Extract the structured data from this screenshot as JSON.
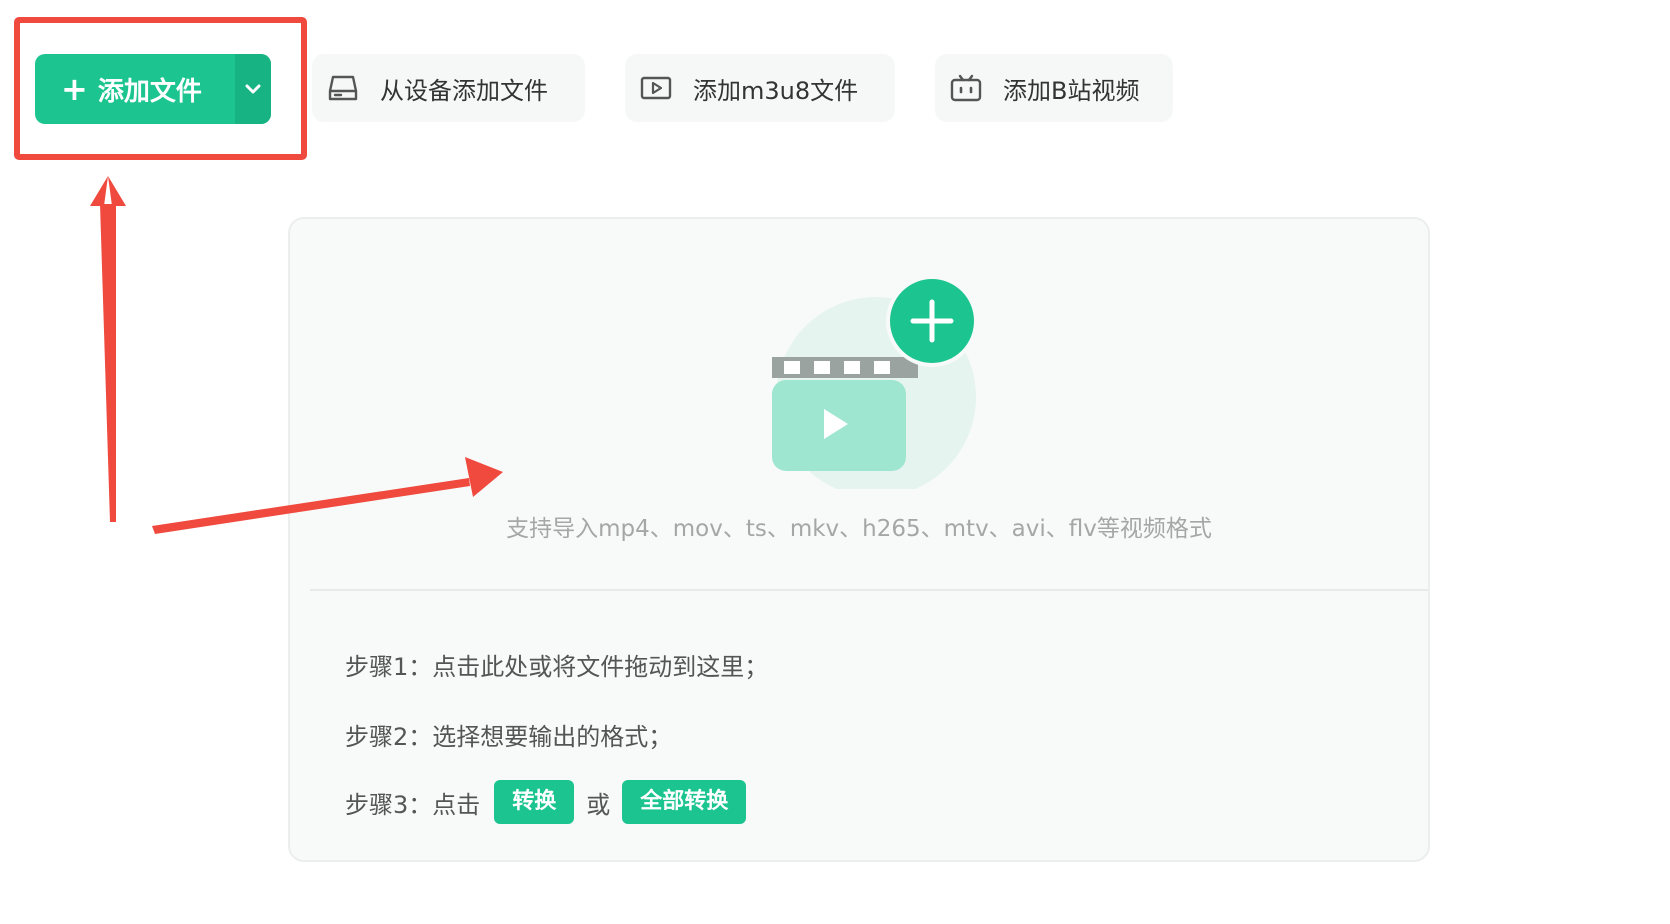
{
  "toolbar": {
    "add_file_label": "添加文件",
    "add_from_device_label": "从设备添加文件",
    "add_m3u8_label": "添加m3u8文件",
    "add_bilibili_label": "添加B站视频"
  },
  "dropzone": {
    "formats_hint": "支持导入mp4、mov、ts、mkv、h265、mtv、avi、flv等视频格式",
    "step1": "步骤1：点击此处或将文件拖动到这里；",
    "step2": "步骤2：选择想要输出的格式；",
    "step3_lead": "步骤3：点击",
    "convert_label": "转换",
    "or_text": "或",
    "convert_all_label": "全部转换"
  },
  "colors": {
    "brand_green": "#1cc58f",
    "annotation_red": "#f04a3f"
  },
  "icons": {
    "add": "plus-icon",
    "dropdown": "chevron-down-icon",
    "device": "hard-drive-icon",
    "m3u8": "video-play-icon",
    "bilibili": "bilibili-tv-icon",
    "illustration": "video-add-illustration"
  }
}
